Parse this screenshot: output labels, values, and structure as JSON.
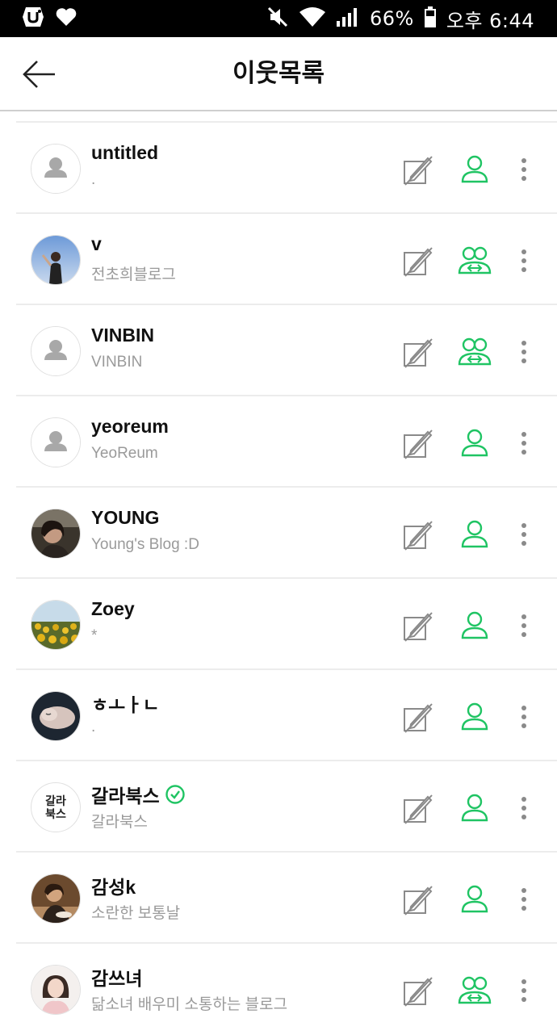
{
  "status_bar": {
    "battery_text": "66%",
    "time_text": "오후 6:44"
  },
  "header": {
    "title": "이웃목록"
  },
  "neighbors": [
    {
      "name": "untitled",
      "subtitle": ".",
      "avatar": "default-avatar",
      "relation": "following",
      "verified": false
    },
    {
      "name": "v",
      "subtitle": "전초희블로그",
      "avatar": "photo-person-sky",
      "relation": "mutual",
      "verified": false
    },
    {
      "name": "VINBIN",
      "subtitle": "VINBIN",
      "avatar": "default-avatar",
      "relation": "mutual",
      "verified": false
    },
    {
      "name": "yeoreum",
      "subtitle": "YeoReum",
      "avatar": "default-avatar",
      "relation": "following",
      "verified": false
    },
    {
      "name": "YOUNG",
      "subtitle": "Young's Blog :D",
      "avatar": "photo-person-dark",
      "relation": "following",
      "verified": false
    },
    {
      "name": "Zoey",
      "subtitle": "*",
      "avatar": "photo-sunflowers",
      "relation": "following",
      "verified": false
    },
    {
      "name": "ㅎㅗㅏㄴ",
      "subtitle": ".",
      "avatar": "photo-sleeping-pet",
      "relation": "following",
      "verified": false
    },
    {
      "name": "갈라북스",
      "subtitle": "갈라북스",
      "avatar": "logo-galabooks",
      "avatar_text": "갈라북스",
      "relation": "following",
      "verified": true
    },
    {
      "name": "감성k",
      "subtitle": "소란한 보통날",
      "avatar": "photo-person-warm",
      "relation": "following",
      "verified": false
    },
    {
      "name": "감쓰녀",
      "subtitle": "닮소녀 배우미 소통하는 블로그",
      "avatar": "photo-woman-portrait",
      "relation": "mutual",
      "verified": false
    }
  ],
  "colors": {
    "accent_green": "#1fc463",
    "icon_gray": "#8a8a8a",
    "subtitle_gray": "#9a9a9a",
    "divider": "#ececec"
  },
  "icons": {
    "write_post": "write-off-icon",
    "following": "neighbor-icon",
    "mutual": "mutual-neighbor-icon",
    "more": "more-vert-icon",
    "back": "back-arrow-icon"
  }
}
